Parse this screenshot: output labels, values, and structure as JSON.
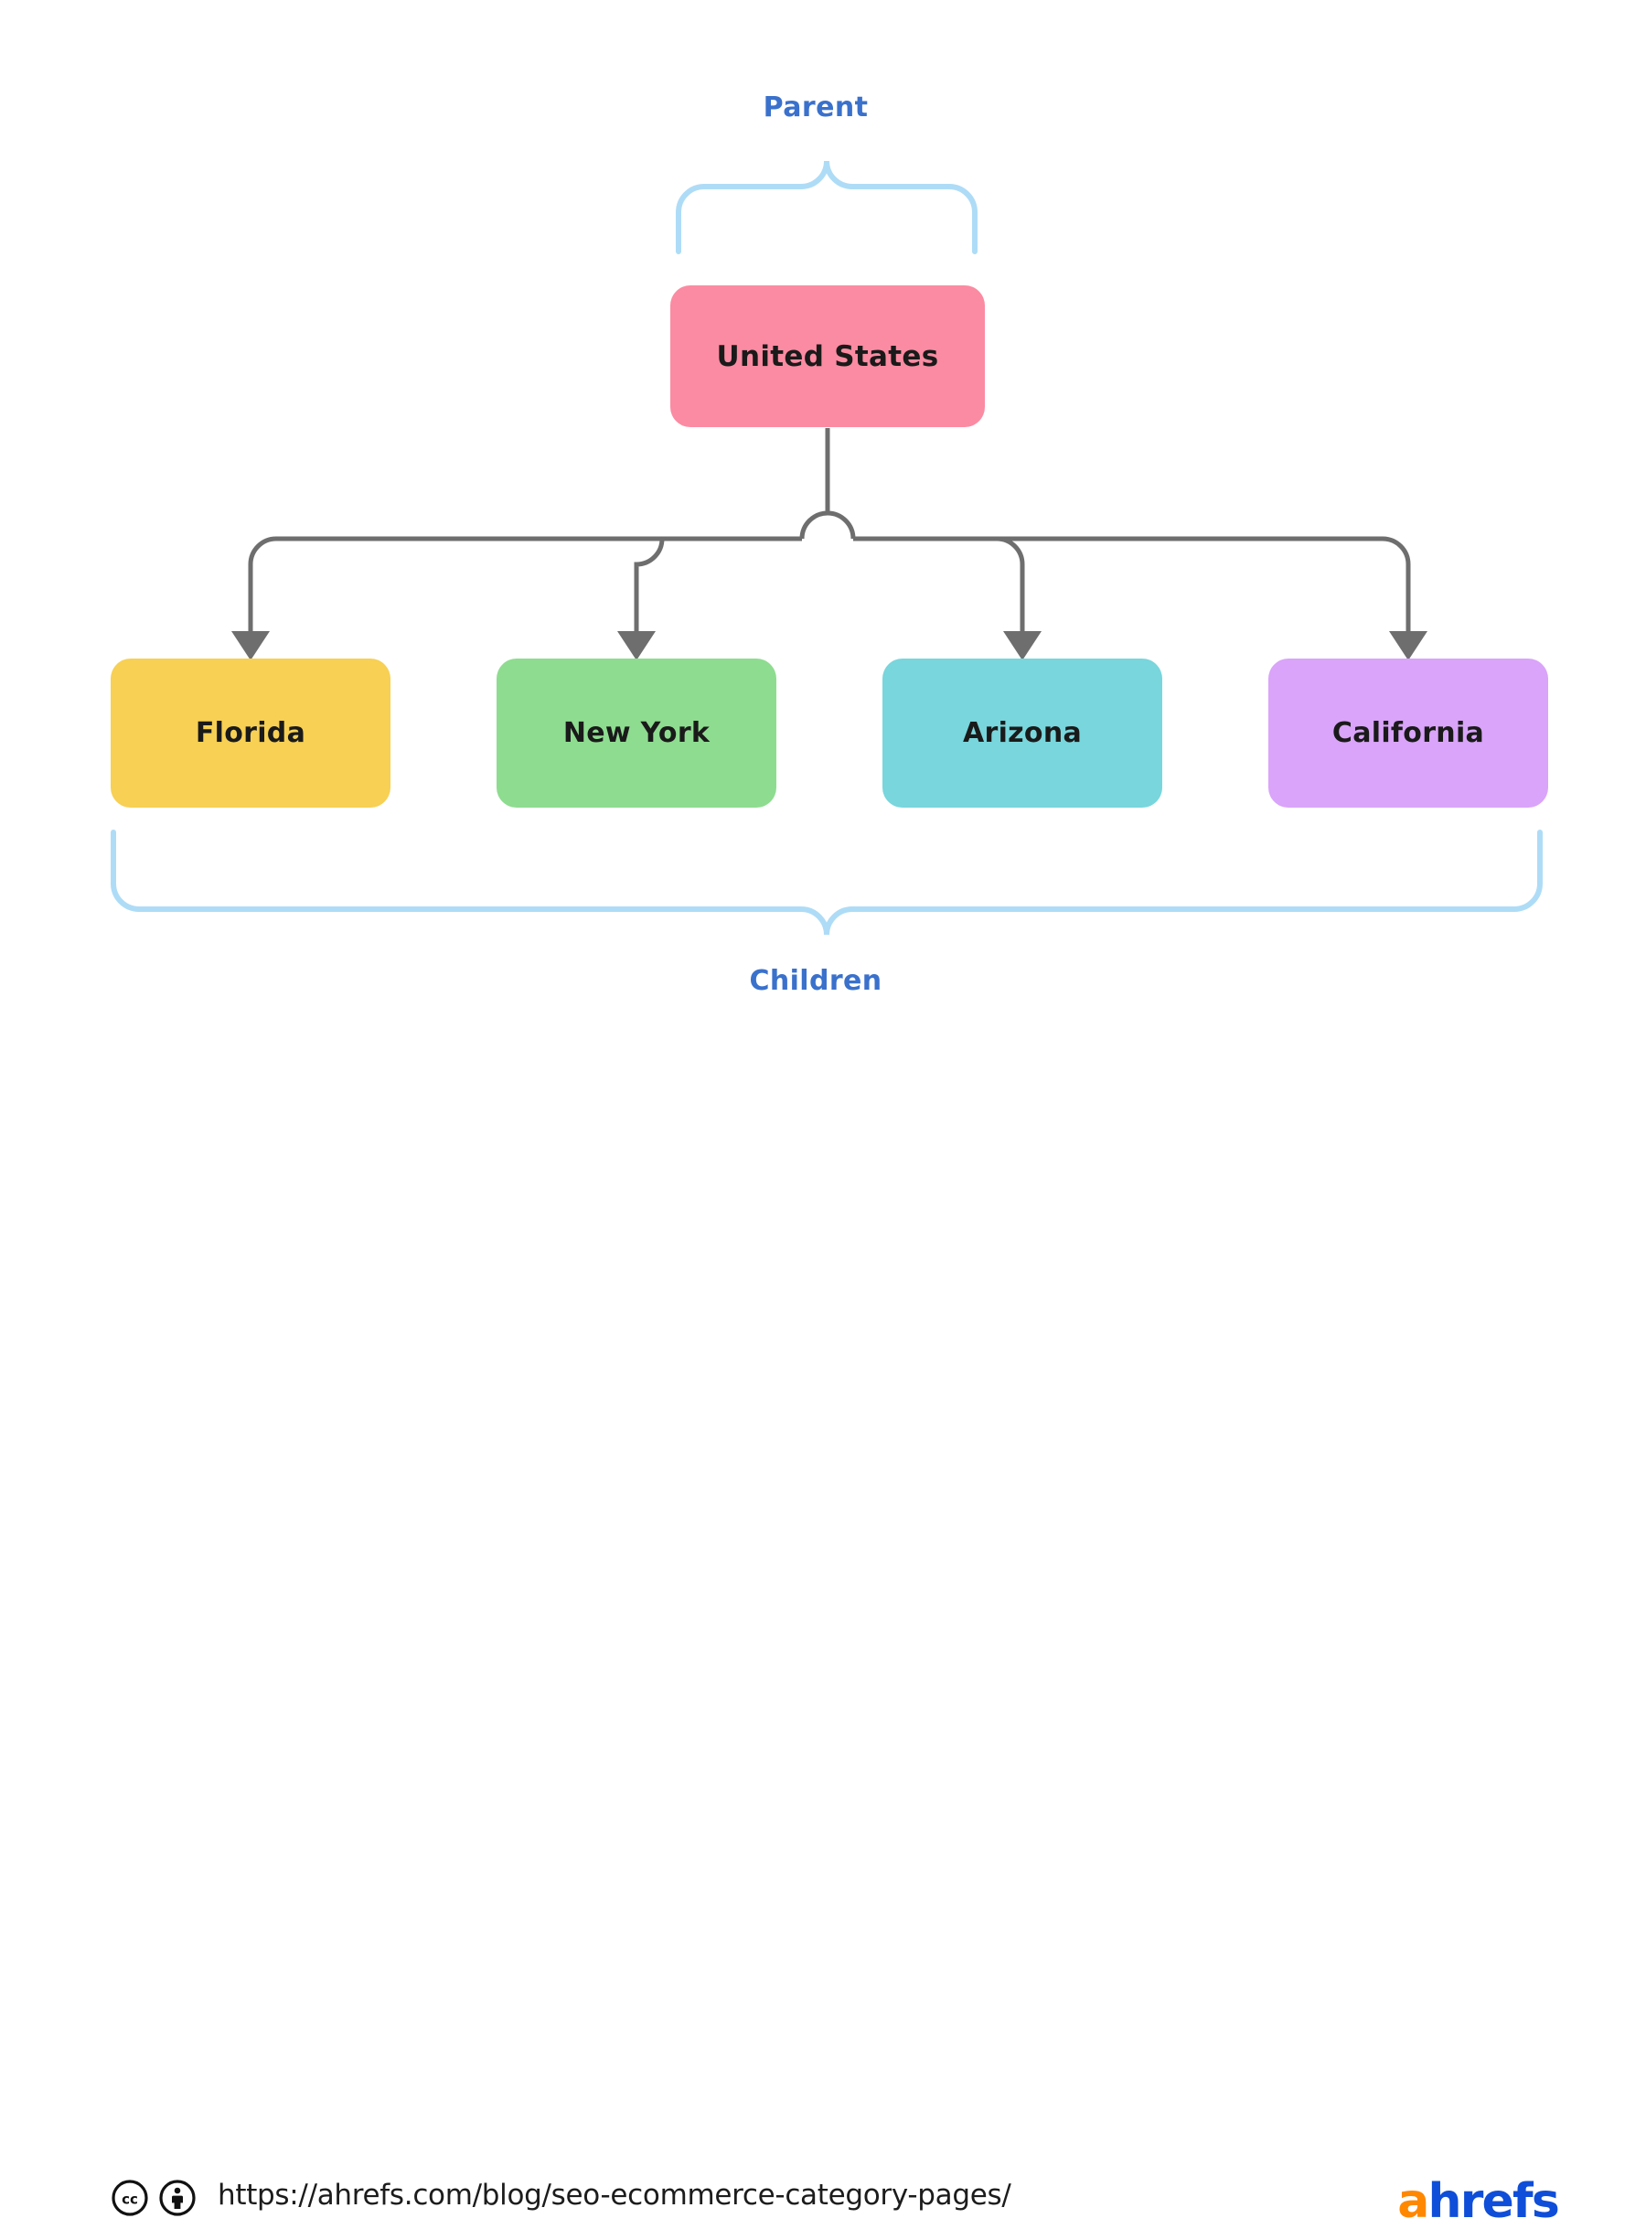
{
  "diagram": {
    "type": "hierarchy-tree",
    "background_color": "#ffffff",
    "parent_label": "Parent",
    "children_label": "Children",
    "label_color": "#3a71cc",
    "brace_color": "#aedcf7",
    "connector_color": "#6e6e6e",
    "parent_node": {
      "label": "United States",
      "color": "#fb8ba2",
      "text_color": "#1a1a1a"
    },
    "child_nodes": [
      {
        "label": "Florida",
        "color": "#f7d054",
        "text_color": "#1a1a1a"
      },
      {
        "label": "New York",
        "color": "#8edc90",
        "text_color": "#1a1a1a"
      },
      {
        "label": "Arizona",
        "color": "#78d6dc",
        "text_color": "#1a1a1a"
      },
      {
        "label": "California",
        "color": "#d9a4f9",
        "text_color": "#1a1a1a"
      }
    ]
  },
  "footer": {
    "url": "https://ahrefs.com/blog/seo-ecommerce-category-pages/",
    "license_icons": [
      "cc-icon",
      "cc-by-attribution-icon"
    ],
    "logo": {
      "first_letter": "a",
      "rest": "hrefs",
      "first_letter_color": "#ff8800",
      "rest_color": "#0f4ed8"
    }
  }
}
